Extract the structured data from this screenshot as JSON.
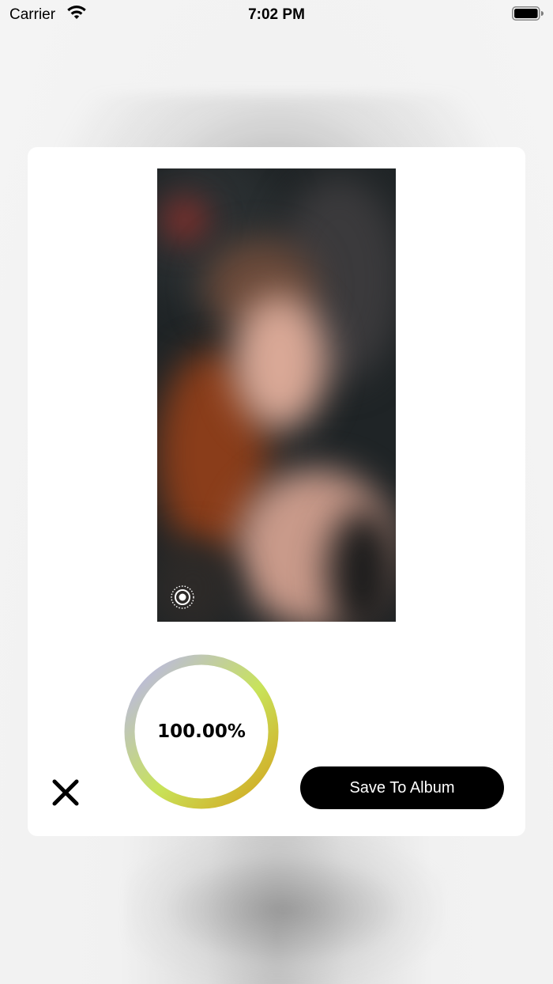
{
  "status_bar": {
    "carrier": "Carrier",
    "time": "7:02 PM",
    "wifi_icon": "wifi-icon",
    "battery_icon": "battery-full-icon"
  },
  "preview": {
    "live_icon": "live-photo-icon"
  },
  "progress": {
    "value_text": "100.00%",
    "fraction": 1.0,
    "gradient_colors": [
      "#d4a21c",
      "#c8e35a",
      "#b9b3f5"
    ]
  },
  "actions": {
    "close_icon": "close-icon",
    "save_label": "Save To Album",
    "save_color": "#000000"
  }
}
